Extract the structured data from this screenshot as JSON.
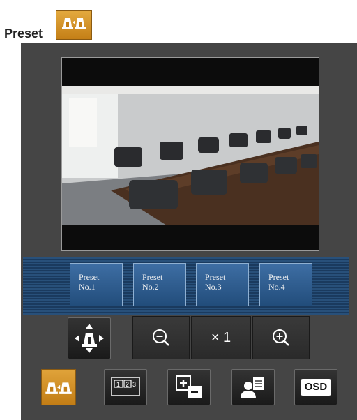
{
  "page": {
    "heading": "Preset",
    "heading_icon": "preset-mode-icon",
    "accent_color": "#d18b1f"
  },
  "viewer": {
    "content": "camera-feed-conference-room"
  },
  "presets": {
    "items": [
      {
        "line1": "Preset",
        "line2": "No.1"
      },
      {
        "line1": "Preset",
        "line2": "No.2"
      },
      {
        "line1": "Preset",
        "line2": "No.3"
      },
      {
        "line1": "Preset",
        "line2": "No.4"
      }
    ]
  },
  "controls": {
    "pan_tilt_icon": "pan-tilt-icon",
    "zoom_out_icon": "zoom-out-icon",
    "zoom_level": "× 1",
    "zoom_in_icon": "zoom-in-icon"
  },
  "toolbar": {
    "preset_mode_icon": "preset-mode-icon",
    "multi_screen_icon": "multi-screen-icon",
    "brightness_icon": "brightness-plus-minus-icon",
    "user_icon": "user-settings-icon",
    "osd_label": "OSD"
  }
}
